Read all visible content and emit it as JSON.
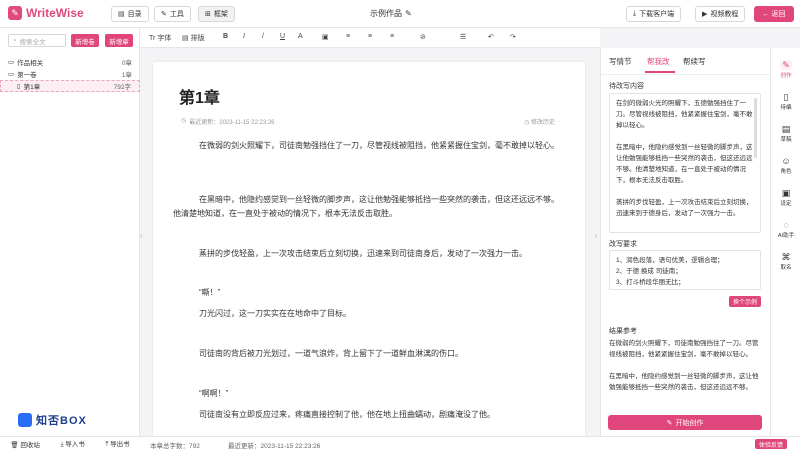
{
  "app": {
    "name": "WriteWise"
  },
  "header": {
    "dir_label": "目录",
    "tools_label": "工具",
    "frame_label": "框架",
    "doc_title": "示例作品",
    "download_label": "下载客户端",
    "video_label": "视频教程",
    "back_label": "返回"
  },
  "sidebar": {
    "search_placeholder": "搜索全文",
    "new_volume": "新增卷",
    "new_chapter": "新增章",
    "tree": [
      {
        "label": "作品相关",
        "count": "0章"
      },
      {
        "label": "第一卷",
        "count": "1章"
      },
      {
        "label": "第1章",
        "count": "792字"
      }
    ],
    "brand": "知否BOX",
    "bottom": [
      "回收站",
      "导入书",
      "导出书"
    ]
  },
  "toolbar": {
    "font_label": "字体",
    "layout_label": "排版",
    "items": [
      "B",
      "I",
      "/",
      "U",
      "A",
      "▣",
      "≡",
      "≡",
      "≡",
      "⊘",
      "☰",
      "↶",
      "↷"
    ]
  },
  "editor": {
    "chapter_title": "第1章",
    "updated": "最近更新：2023-11-15 22:23:26",
    "history_label": "修改历史",
    "paragraphs": [
      "在微弱的剑火照耀下，司徒南勉强挡住了一刀，尽管视线被阻挡，他紧紧握住宝剑，毫不敢掉以轻心。",
      "在黑暗中，他隐约感觉到一丝轻微的脚步声，这让他勉强能够抵挡一些突然的袭击，但这还远远不够。他清楚地知道，在一直处于被动的情况下，根本无法反击取胜。",
      "蒸拼的步伐轻盈，上一次攻击结束后立刻切换，迅速来到司徒南身后，发动了一次强力一击。",
      "“嘶！”",
      "刀光闪过，这一刀实实在在地命中了目标。",
      "司徒南的背后被刀光划过，一道气浪炸，背上留下了一道鲜血淋漓的伤口。",
      "“啊啊！”",
      "司徒南没有立即反应过来，疼痛直接控制了他，他在地上扭曲蠕动，剧痛淹没了他。"
    ]
  },
  "status": {
    "word_count": "本章总字数：792",
    "time": "最近更新：2023-11-15 22:23:26",
    "feedback": "体验反馈"
  },
  "assistant": {
    "tabs": [
      "写情节",
      "帮我改",
      "帮续写"
    ],
    "active_tab": 1,
    "to_edit_label": "待改写内容",
    "to_edit_text": [
      "在剑的微弱火光的照耀下，五德勉强挡住了一刀。尽管视线被阻挡，他紧紧握住宝剑，毫不敢掉以轻心。",
      "在黑暗中，他隐约感觉到一丝轻微的脚步声，这让他勉强能够抵挡一些突然的袭击，但这还远远不够。他清楚地知道，在一直处于被动的情况下，根本无法反击取胜。",
      "蒸拼的步伐轻盈，上一次攻击结束后立刻切换，迅速来到于德身后，发动了一次强力一击。"
    ],
    "requirements_label": "改写要求",
    "requirements": [
      "1、润色段落，语句优美，逻辑合理；",
      "2、于德 换成 司徒南；",
      "3、打斗桥段华丽无比；"
    ],
    "example_button": "换个示例",
    "result_label": "结果参考",
    "result_text": [
      "在微弱的剑火照耀下，司徒南勉强挡住了一刀。尽管视线被阻挡，他紧紧握住宝剑，毫不敢掉以轻心。",
      "在黑暗中，他隐约感觉到一丝轻微的脚步声，这让他勉强能够抵挡一些突然的袭击，但这还远远不够。"
    ],
    "start_label": "开始创作"
  },
  "rail": [
    {
      "label": "创作",
      "icon": "pen-icon"
    },
    {
      "label": "待编",
      "icon": "doc-icon"
    },
    {
      "label": "草稿",
      "icon": "draft-icon"
    },
    {
      "label": "角色",
      "icon": "person-icon"
    },
    {
      "label": "设定",
      "icon": "settings-card-icon"
    },
    {
      "label": "AI助手",
      "icon": "chat-icon"
    },
    {
      "label": "取名",
      "icon": "tag-icon"
    }
  ]
}
